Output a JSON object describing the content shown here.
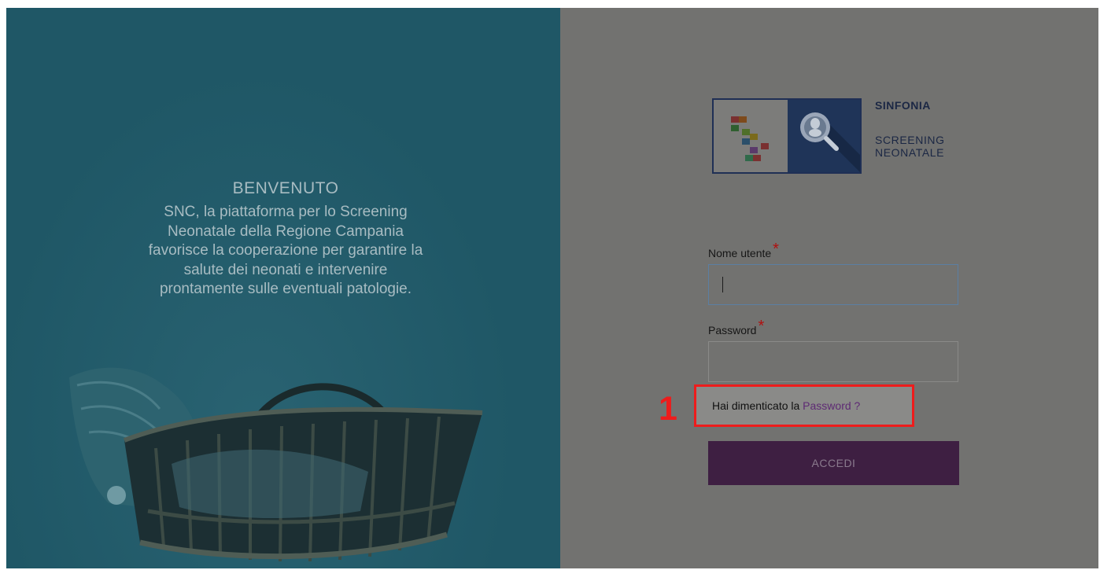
{
  "welcome": {
    "title": "BENVENUTO",
    "lines": [
      "SNC, la piattaforma per lo Screening",
      "Neonatale della Regione Campania",
      "favorisce la cooperazione per garantire la",
      "salute dei neonati e intervenire",
      "prontamente sulle eventuali patologie."
    ]
  },
  "brand": {
    "name": "SINFONIA",
    "sub_line1": "SCREENING",
    "sub_line2": "NEONATALE"
  },
  "login": {
    "username_label": "Nome utente",
    "password_label": "Password",
    "required_mark": "*",
    "username_value": "",
    "password_value": "",
    "forgot_prefix": "Hai dimenticato la ",
    "forgot_link": "Password ?",
    "submit_label": "ACCEDI"
  },
  "annotation": {
    "step_number": "1"
  },
  "colors": {
    "left_panel": "#1f5766",
    "right_panel": "#727270",
    "button": "#3e1f42",
    "highlight": "#ee1c1c",
    "link": "#5e2a74"
  },
  "icons": [
    "baby-basket-illustration",
    "sinfonia-blocks-logo",
    "magnifier-baby-icon"
  ]
}
